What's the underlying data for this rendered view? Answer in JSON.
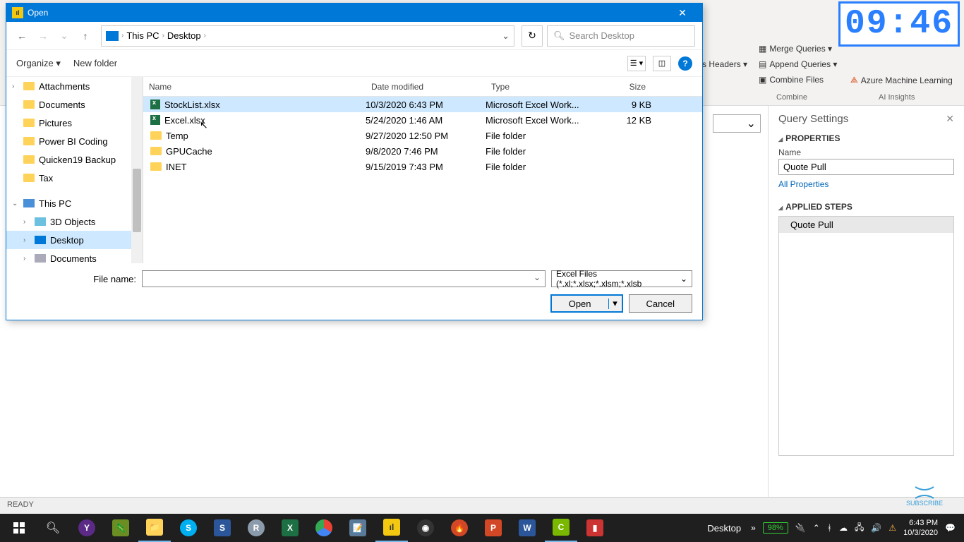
{
  "timer": "09:46",
  "subscribe_label": "SUBSCRIBE",
  "ribbon": {
    "headers": "s Headers ▾",
    "merge": "Merge Queries ▾",
    "append": "Append Queries ▾",
    "combine_files": "Combine Files",
    "azure": "Azure Machine Learning",
    "group_combine": "Combine",
    "group_ai": "AI Insights"
  },
  "query_settings": {
    "title": "Query Settings",
    "properties": "PROPERTIES",
    "name_label": "Name",
    "name_value": "Quote Pull",
    "all_props": "All Properties",
    "applied_steps": "APPLIED STEPS",
    "step1": "Quote Pull"
  },
  "statusbar": "READY",
  "dialog": {
    "title": "Open",
    "breadcrumb": {
      "root": "This PC",
      "loc": "Desktop"
    },
    "search_placeholder": "Search Desktop",
    "organize": "Organize ▾",
    "new_folder": "New folder",
    "columns": {
      "name": "Name",
      "date": "Date modified",
      "type": "Type",
      "size": "Size"
    },
    "tree": [
      {
        "label": "Attachments",
        "icon": "folder",
        "chev": "›"
      },
      {
        "label": "Documents",
        "icon": "folder"
      },
      {
        "label": "Pictures",
        "icon": "folder"
      },
      {
        "label": "Power BI Coding",
        "icon": "folder"
      },
      {
        "label": "Quicken19 Backup",
        "icon": "folder"
      },
      {
        "label": "Tax",
        "icon": "folder"
      },
      {
        "label": "",
        "spacer": true
      },
      {
        "label": "This PC",
        "icon": "pc",
        "chev": "⌄",
        "indent": 0
      },
      {
        "label": "3D Objects",
        "icon": "obj3d",
        "chev": "›",
        "indent": 1
      },
      {
        "label": "Desktop",
        "icon": "desk",
        "chev": "›",
        "indent": 1,
        "sel": true
      },
      {
        "label": "Documents",
        "icon": "doc",
        "chev": "›",
        "indent": 1
      }
    ],
    "files": [
      {
        "name": "StockList.xlsx",
        "date": "10/3/2020 6:43 PM",
        "type": "Microsoft Excel Work...",
        "size": "9 KB",
        "icon": "excel",
        "sel": true
      },
      {
        "name": "Excel.xlsx",
        "date": "5/24/2020 1:46 AM",
        "type": "Microsoft Excel Work...",
        "size": "12 KB",
        "icon": "excel"
      },
      {
        "name": "Temp",
        "date": "9/27/2020 12:50 PM",
        "type": "File folder",
        "size": "",
        "icon": "folder"
      },
      {
        "name": "GPUCache",
        "date": "9/8/2020 7:46 PM",
        "type": "File folder",
        "size": "",
        "icon": "folder"
      },
      {
        "name": "INET",
        "date": "9/15/2019 7:43 PM",
        "type": "File folder",
        "size": "",
        "icon": "folder"
      }
    ],
    "file_name_label": "File name:",
    "file_name_value": "",
    "filter": "Excel Files (*.xl;*.xlsx;*.xlsm;*.xlsb",
    "open": "Open",
    "cancel": "Cancel"
  },
  "taskbar": {
    "desktop_label": "Desktop",
    "battery": "98%",
    "time": "6:43 PM",
    "date": "10/3/2020"
  }
}
